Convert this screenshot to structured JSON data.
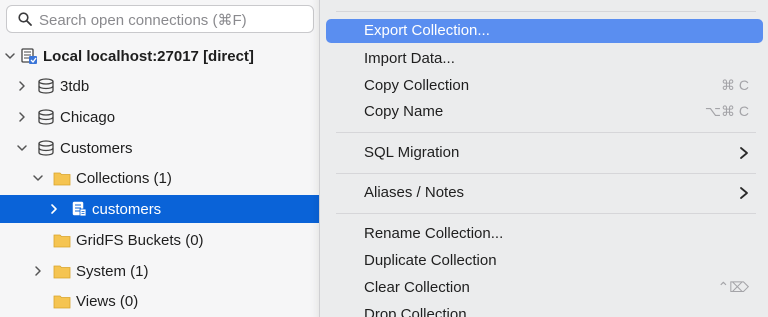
{
  "search": {
    "placeholder": "Search open connections (⌘F)"
  },
  "tree": {
    "connection": {
      "label": "Local localhost:27017 [direct]"
    },
    "databases": [
      {
        "label": "3tdb"
      },
      {
        "label": "Chicago"
      },
      {
        "label": "Customers"
      }
    ],
    "collections_folder": {
      "label": "Collections (1)"
    },
    "selected_collection": {
      "label": "customers"
    },
    "gridfs": {
      "label": "GridFS Buckets (0)"
    },
    "system": {
      "label": "System (1)"
    },
    "views": {
      "label": "Views (0)"
    }
  },
  "context_menu": {
    "items": [
      {
        "label": "Export Collection...",
        "shortcut": ""
      },
      {
        "label": "Import Data...",
        "shortcut": ""
      },
      {
        "label": "Copy Collection",
        "shortcut": "⌘ C"
      },
      {
        "label": "Copy Name",
        "shortcut": "⌥⌘ C"
      },
      {
        "label": "SQL Migration",
        "submenu": true
      },
      {
        "label": "Aliases / Notes",
        "submenu": true
      },
      {
        "label": "Rename Collection...",
        "shortcut": ""
      },
      {
        "label": "Duplicate Collection",
        "shortcut": ""
      },
      {
        "label": "Clear Collection",
        "shortcut": "⌃⌦"
      },
      {
        "label": "Drop Collection",
        "shortcut": ""
      }
    ]
  },
  "colors": {
    "selection": "#0a63d8",
    "menu_highlight": "#5a8ef0",
    "folder": "#f5c451"
  }
}
